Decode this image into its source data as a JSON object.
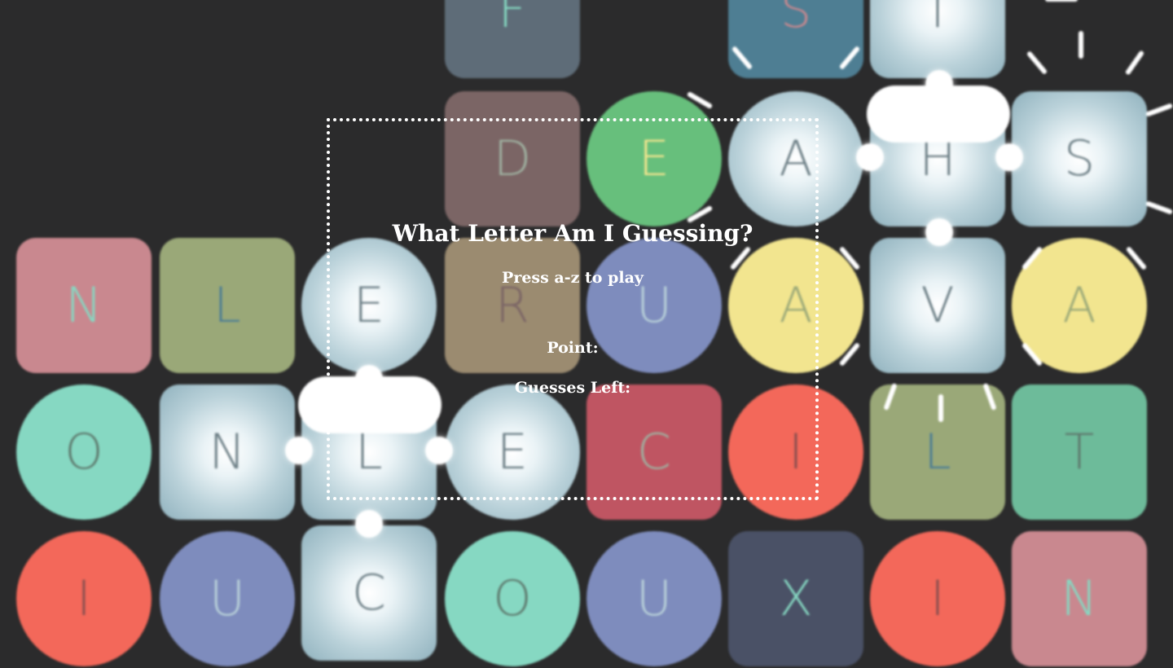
{
  "game": {
    "title": "What Letter Am I Guessing?",
    "instruction": "Press a-z to play",
    "point_label": "Point:",
    "guesses_left_label": "Guesses Left:"
  },
  "board": {
    "rows": [
      [
        "",
        "",
        "",
        "F",
        "",
        "S",
        "T",
        ""
      ],
      [
        "",
        "",
        "",
        "D",
        "E",
        "A",
        "H",
        "S"
      ],
      [
        "N",
        "L",
        "E",
        "R",
        "U",
        "A",
        "V",
        "A"
      ],
      [
        "O",
        "N",
        "L",
        "E",
        "C",
        "I",
        "L",
        "T"
      ],
      [
        "I",
        "U",
        "C",
        "O",
        "U",
        "X",
        "I",
        "N"
      ]
    ]
  },
  "colors": {
    "background": "#2b2b2c",
    "pink": "#c9888f",
    "olive": "#9aa878",
    "mint": "#86d8c2",
    "coral": "#f3685a",
    "periwinkle": "#7e8cbd",
    "tan": "#9b8b70",
    "rose": "#bf5562",
    "slate": "#5e6c78",
    "mauve": "#7b6565",
    "green": "#67bf7c",
    "yellow": "#f2e58f",
    "teal": "#6dbb9a",
    "navy": "#4a5166",
    "steel": "#4e7e93"
  }
}
